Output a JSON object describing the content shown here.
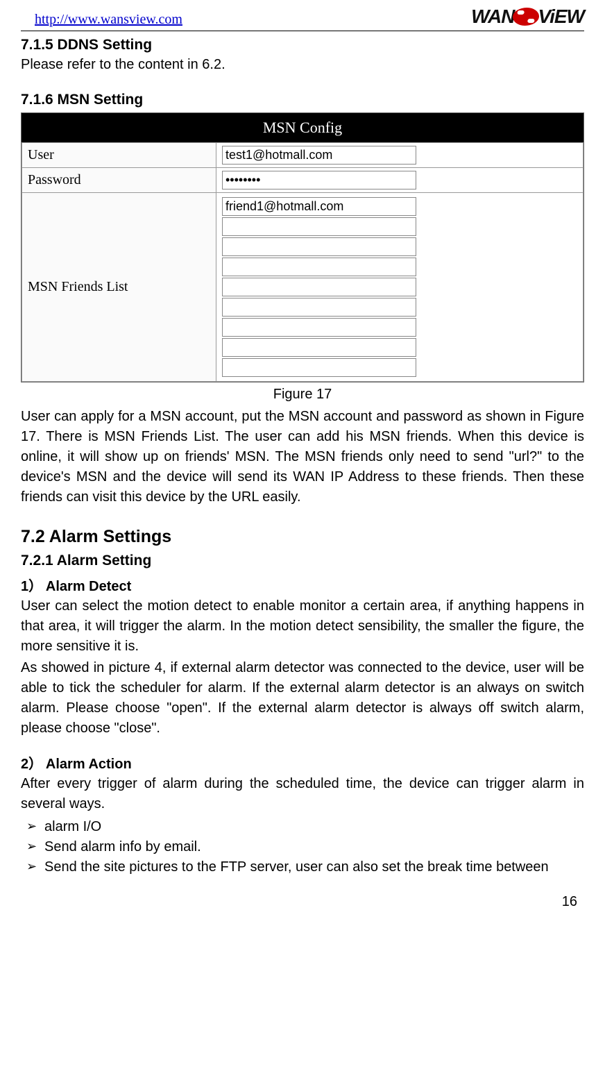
{
  "header": {
    "url": "http://www.wansview.com",
    "logo_wan": "WAN",
    "logo_view": "ViEW"
  },
  "sec_715": {
    "heading": "7.1.5   DDNS Setting",
    "body": "Please refer to the content in 6.2."
  },
  "sec_716": {
    "heading": "7.1.6   MSN Setting",
    "config_title": "MSN Config",
    "rows": {
      "user_label": "User",
      "user_value": "test1@hotmall.com",
      "password_label": "Password",
      "password_value": "••••••••",
      "friends_label": "MSN Friends List",
      "friends": [
        "friend1@hotmall.com",
        "",
        "",
        "",
        "",
        "",
        "",
        "",
        ""
      ]
    },
    "caption": "Figure 17",
    "body": "User can apply for a MSN account, put the MSN account and password as shown in Figure 17. There is MSN Friends List. The user can add his MSN friends. When this device is online, it will show up on friends' MSN. The MSN friends only need to send \"url?\" to the device's MSN and the device will send its WAN IP Address to these friends. Then these friends can visit this device by the URL easily."
  },
  "sec_72": {
    "heading": "7.2   Alarm Settings"
  },
  "sec_721": {
    "heading": "7.2.1   Alarm Setting",
    "sub1_title": "1） Alarm Detect",
    "sub1_body1": "User can select the motion detect to enable monitor a certain area, if anything happens in that area, it will trigger the alarm. In the motion detect sensibility, the smaller the figure, the more sensitive it is.",
    "sub1_body2": "As showed in picture 4, if external alarm detector was connected to the device, user will be able to tick the scheduler for alarm. If the external alarm detector is an always on switch alarm. Please choose \"open\". If the external alarm detector is always off switch alarm, please choose \"close\".",
    "sub2_title": "2） Alarm Action",
    "sub2_body": "After every trigger of alarm during the scheduled time, the device can trigger alarm in several ways.",
    "bullets": [
      "alarm I/O",
      "Send alarm info by email.",
      "Send the site pictures to the FTP server, user can also set the break time between"
    ]
  },
  "pagenum": "16"
}
